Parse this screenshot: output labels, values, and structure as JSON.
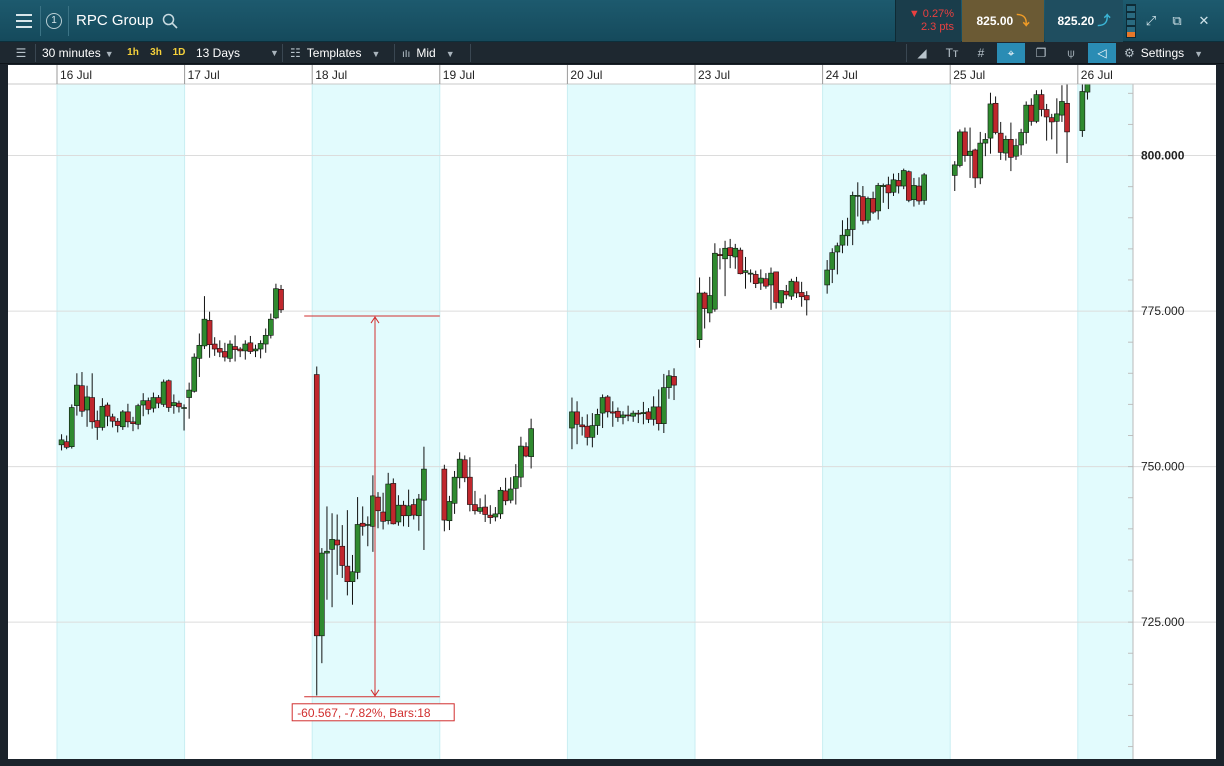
{
  "header": {
    "title": "RPC Group",
    "change_pct": "▼ 0.27%",
    "change_pts": "2.3 pts",
    "sell_price": "825.00",
    "buy_price": "825.20",
    "info_label": "1",
    "colors": {
      "down": "#e94040",
      "sell_arrow": "#f19c26",
      "buy_arrow": "#3bb5d6"
    }
  },
  "toolbar": {
    "interval": "30 minutes",
    "quick_ranges": [
      "1h",
      "3h",
      "1D"
    ],
    "span": "13 Days",
    "templates_label": "Templates",
    "price_type": "Mid",
    "settings_label": "Settings",
    "icons": [
      "list-icon",
      "draw-line-icon",
      "text-tool-icon",
      "grid-icon",
      "crosshair-icon",
      "layers-icon",
      "indicator-icon",
      "tag-icon",
      "gear-icon"
    ]
  },
  "chart_data": {
    "type": "candlestick",
    "x_labels": [
      "16 Jul",
      "17 Jul",
      "18 Jul",
      "19 Jul",
      "20 Jul",
      "23 Jul",
      "24 Jul",
      "25 Jul",
      "26 Jul"
    ],
    "y_ticks": [
      "800.000",
      "775.000",
      "750.000",
      "725.000"
    ],
    "y_tick_values": [
      800,
      775,
      750,
      725
    ],
    "ylim": [
      703,
      811.5
    ],
    "grid": true,
    "colors": {
      "up": "#2f8a2f",
      "down": "#c0272d",
      "band": "#e2fbfd",
      "measure": "#d12f2f"
    },
    "measure": {
      "top": 774.2,
      "bottom": 713,
      "label": "-60.567, -7.82%, Bars:18"
    },
    "days": [
      {
        "label": "16 Jul",
        "ohlc": [
          [
            753.5,
            755.2,
            752.6,
            754.3
          ],
          [
            754,
            755,
            752.8,
            753.1
          ],
          [
            753.2,
            760,
            752.9,
            759.5
          ],
          [
            759.8,
            765,
            758.2,
            763.1
          ],
          [
            763,
            765.2,
            758,
            758.9
          ],
          [
            759.1,
            763,
            756.4,
            761.2
          ],
          [
            761.1,
            765,
            756.1,
            757.2
          ],
          [
            757.4,
            759,
            754.3,
            756.3
          ],
          [
            756.3,
            761,
            755.8,
            759.7
          ],
          [
            759.9,
            760.3,
            756.5,
            758.1
          ],
          [
            758,
            758.5,
            756.3,
            757.3
          ],
          [
            757.3,
            757.8,
            755.5,
            756.6
          ],
          [
            756.4,
            759.1,
            755.9,
            758.8
          ],
          [
            758.8,
            760.1,
            756.3,
            757.2
          ],
          [
            757.2,
            758,
            755.7,
            756.9
          ],
          [
            756.8,
            760.1,
            756,
            759.8
          ],
          [
            759.9,
            761.8,
            758.1,
            760.6
          ],
          [
            760.6,
            761.1,
            758.4,
            759.2
          ],
          [
            759.4,
            761.9,
            758.7,
            761.1
          ],
          [
            761.1,
            761.5,
            759.4,
            760.2
          ],
          [
            760,
            764,
            759.6,
            763.6
          ],
          [
            763.8,
            764,
            758.8,
            759.5
          ],
          [
            759.8,
            761.6,
            758.5,
            760.3
          ],
          [
            760.2,
            760.6,
            758.7,
            759.6
          ],
          [
            759.4,
            760,
            755.8,
            759.5
          ]
        ]
      },
      {
        "label": "17 Jul",
        "ohlc": [
          [
            761.1,
            763.5,
            757.7,
            762.3
          ],
          [
            762.1,
            768.2,
            761.9,
            767.6
          ],
          [
            767.4,
            771.4,
            764.4,
            769.5
          ],
          [
            769.4,
            777.4,
            768.9,
            773.7
          ],
          [
            773.5,
            774.9,
            767.5,
            769.6
          ],
          [
            769.7,
            770.8,
            767.8,
            768.9
          ],
          [
            769,
            770.3,
            767.6,
            768.4
          ],
          [
            768.5,
            769.9,
            766.9,
            767.6
          ],
          [
            767.4,
            770.3,
            766.8,
            769.7
          ],
          [
            769.3,
            771.1,
            766.9,
            768.8
          ],
          [
            768.9,
            769.2,
            767.6,
            768.6
          ],
          [
            768.6,
            770.3,
            767.2,
            769.7
          ],
          [
            769.9,
            771,
            768.1,
            768.5
          ],
          [
            768.6,
            769.6,
            767.6,
            768.9
          ],
          [
            768.9,
            770.3,
            767.4,
            769.8
          ],
          [
            769.7,
            772.2,
            768.3,
            771.1
          ],
          [
            771.1,
            774.6,
            770.6,
            773.7
          ],
          [
            773.9,
            779.4,
            773.7,
            778.6
          ],
          [
            778.5,
            779.2,
            774.7,
            775.2
          ]
        ]
      },
      {
        "label": "18 Jul",
        "ohlc": [
          [
            764.8,
            766.1,
            713.2,
            722.8
          ],
          [
            722.8,
            736.9,
            718.4,
            736.1
          ],
          [
            736.1,
            743.6,
            728.6,
            736.4
          ],
          [
            736.7,
            742.5,
            727.4,
            738.3
          ],
          [
            738.2,
            742.3,
            732.6,
            737.4
          ],
          [
            737.2,
            740.6,
            732.1,
            734.1
          ],
          [
            734,
            743,
            729.3,
            731.5
          ],
          [
            731.5,
            735.8,
            727.8,
            733.1
          ],
          [
            733,
            745.1,
            731.9,
            740.7
          ],
          [
            740.9,
            743.6,
            738.9,
            740.4
          ],
          [
            740.6,
            742,
            737.2,
            740.7
          ],
          [
            740.4,
            748.6,
            736.3,
            745.3
          ],
          [
            745.1,
            745.9,
            740.1,
            742.9
          ],
          [
            742.7,
            745.8,
            739.9,
            741.2
          ],
          [
            741.3,
            749,
            740.7,
            747.2
          ],
          [
            747.3,
            748.1,
            740.7,
            740.8
          ],
          [
            741.1,
            745.4,
            740.5,
            743.8
          ],
          [
            743.8,
            744.5,
            740.4,
            742.1
          ],
          [
            742.1,
            746.3,
            740.3,
            743.7
          ],
          [
            743.9,
            744.8,
            741.5,
            742.2
          ],
          [
            742.1,
            745.6,
            739.7,
            744.8
          ],
          [
            744.6,
            753.2,
            736.6,
            749.6
          ]
        ]
      },
      {
        "label": "19 Jul",
        "ohlc": [
          [
            749.6,
            750.3,
            739.6,
            741.4
          ],
          [
            741.3,
            745.3,
            739.8,
            744.4
          ],
          [
            744.1,
            749.3,
            742.4,
            748.3
          ],
          [
            748.2,
            752.3,
            746.5,
            751.2
          ],
          [
            751.1,
            751.8,
            747.5,
            748.2
          ],
          [
            748.3,
            751.5,
            742.8,
            743.9
          ],
          [
            743.9,
            746.1,
            742.3,
            742.9
          ],
          [
            742.8,
            744.9,
            742.4,
            743.4
          ],
          [
            743.5,
            745.5,
            741.1,
            742.3
          ],
          [
            742.2,
            743.8,
            740.8,
            741.8
          ],
          [
            741.9,
            743.5,
            741.2,
            742.4
          ],
          [
            742.4,
            746.7,
            741.6,
            746.2
          ],
          [
            746.1,
            748.2,
            743.8,
            744.5
          ],
          [
            744.6,
            748.3,
            744.1,
            746.4
          ],
          [
            746.5,
            750.4,
            743.9,
            748.4
          ],
          [
            748.3,
            754.8,
            746.7,
            753.3
          ],
          [
            753.2,
            753.9,
            751.5,
            751.7
          ],
          [
            751.6,
            757.7,
            749.7,
            756.1
          ]
        ]
      },
      {
        "label": "20 Jul",
        "ohlc": [
          [
            756.2,
            761.1,
            752.8,
            758.8
          ],
          [
            758.8,
            760.5,
            753.6,
            756.8
          ],
          [
            756.7,
            758,
            755,
            756.4
          ],
          [
            756.5,
            758.4,
            753.4,
            754.7
          ],
          [
            754.7,
            758.6,
            753.1,
            756.6
          ],
          [
            756.6,
            759.3,
            755.1,
            758.4
          ],
          [
            758.6,
            761.6,
            756.2,
            761.1
          ],
          [
            761.2,
            761.5,
            757.9,
            758.8
          ],
          [
            758.8,
            760.5,
            756.4,
            758.6
          ],
          [
            758.9,
            759.5,
            757.2,
            757.9
          ],
          [
            757.9,
            758.9,
            756.8,
            758.3
          ],
          [
            758.3,
            759.8,
            757.3,
            758.2
          ],
          [
            758.1,
            759,
            757.2,
            758.6
          ],
          [
            758.6,
            759.1,
            757,
            758.5
          ],
          [
            758.5,
            760.4,
            756.8,
            758.7
          ],
          [
            758.8,
            759.4,
            757,
            757.6
          ],
          [
            757.6,
            761.3,
            756.6,
            759.6
          ],
          [
            759.6,
            762.4,
            755.8,
            756.9
          ],
          [
            756.9,
            764.9,
            755.4,
            762.7
          ],
          [
            762.7,
            765.5,
            760.9,
            764.6
          ],
          [
            764.5,
            765.8,
            760.7,
            763.1
          ]
        ]
      },
      {
        "label": "23 Jul",
        "ohlc": [
          [
            770.4,
            780.4,
            769.1,
            777.9
          ],
          [
            777.9,
            778.1,
            772.2,
            775.4
          ],
          [
            774.7,
            780.5,
            773.2,
            777.5
          ],
          [
            775.3,
            785.9,
            774.9,
            784.3
          ],
          [
            784.1,
            785.1,
            781.7,
            783.9
          ],
          [
            783.4,
            786.3,
            777.4,
            785.1
          ],
          [
            785.2,
            786.6,
            781.9,
            783.9
          ],
          [
            783.7,
            785.8,
            781.8,
            785.1
          ],
          [
            784.8,
            785.2,
            780.9,
            781
          ],
          [
            781.2,
            783.7,
            778.6,
            781.5
          ],
          [
            781.1,
            781.7,
            779.6,
            781.1
          ],
          [
            780.9,
            781.5,
            778.7,
            779.4
          ],
          [
            779.5,
            781.7,
            778.4,
            780.3
          ],
          [
            780.2,
            781.1,
            778.6,
            779
          ],
          [
            779.2,
            782,
            775.2,
            781.1
          ],
          [
            781.3,
            781.3,
            775.4,
            776.4
          ],
          [
            776.3,
            778.3,
            775.5,
            778.3
          ],
          [
            778.2,
            779.2,
            776.9,
            777.6
          ],
          [
            777.4,
            780.2,
            776.8,
            779.8
          ],
          [
            779.7,
            780.5,
            777.1,
            777.9
          ],
          [
            778,
            779.7,
            775.7,
            777.3
          ],
          [
            777.5,
            778.2,
            774.3,
            776.8
          ]
        ]
      },
      {
        "label": "24 Jul",
        "ohlc": [
          [
            779.2,
            783.2,
            777.8,
            781.6
          ],
          [
            781.7,
            785.1,
            779.5,
            784.4
          ],
          [
            784.5,
            786,
            780.9,
            785.5
          ],
          [
            785.6,
            789.6,
            784.3,
            787.2
          ],
          [
            787.1,
            790,
            785.5,
            788.1
          ],
          [
            788.1,
            794.2,
            785.6,
            793.6
          ],
          [
            793.5,
            795.7,
            790.2,
            793.6
          ],
          [
            793.4,
            795.1,
            788.9,
            789.5
          ],
          [
            789.6,
            793.4,
            789.1,
            793.1
          ],
          [
            793.1,
            794.2,
            790.6,
            790.9
          ],
          [
            791.1,
            795.6,
            789.7,
            795.2
          ],
          [
            795,
            795.5,
            792.4,
            795.2
          ],
          [
            795.3,
            796.6,
            791.4,
            794
          ],
          [
            794.1,
            797.1,
            793.5,
            796.1
          ],
          [
            796,
            797.2,
            793.9,
            795.1
          ],
          [
            795.1,
            797.9,
            794.6,
            797.6
          ],
          [
            797.4,
            797.6,
            792.5,
            792.8
          ],
          [
            792.9,
            796.4,
            791.8,
            795.2
          ],
          [
            795.1,
            796.5,
            792.1,
            792.7
          ],
          [
            792.8,
            797.2,
            792.1,
            796.9
          ]
        ]
      },
      {
        "label": "25 Jul",
        "ohlc": [
          [
            796.8,
            799.1,
            794.3,
            798.5
          ],
          [
            798.4,
            804.2,
            798.1,
            803.8
          ],
          [
            803.8,
            804.5,
            799,
            800
          ],
          [
            800,
            804.5,
            796.4,
            800.7
          ],
          [
            800.9,
            801.1,
            794.8,
            796.4
          ],
          [
            796.4,
            803.8,
            795.4,
            802
          ],
          [
            802,
            803.6,
            799.9,
            802.6
          ],
          [
            802.8,
            810.1,
            800.3,
            808.3
          ],
          [
            808.4,
            809.5,
            803.4,
            803.7
          ],
          [
            803.6,
            805.4,
            799.3,
            800.5
          ],
          [
            800.4,
            803.2,
            799.2,
            802.6
          ],
          [
            802.6,
            805.3,
            797.5,
            799.7
          ],
          [
            799.9,
            802.7,
            799.3,
            801.6
          ],
          [
            801.7,
            804.3,
            800.1,
            803.7
          ],
          [
            803.7,
            808.7,
            801.9,
            808.1
          ],
          [
            808.1,
            809.2,
            804.8,
            805.5
          ],
          [
            805.5,
            810.5,
            805.2,
            809.8
          ],
          [
            809.8,
            810.6,
            806.3,
            807.4
          ],
          [
            807.4,
            808.3,
            802.4,
            806.2
          ],
          [
            806.1,
            806.7,
            802.6,
            805.4
          ],
          [
            805.5,
            809.2,
            800.3,
            806.7
          ],
          [
            806.5,
            811.3,
            805.4,
            808.7
          ],
          [
            808.4,
            812.4,
            798.8,
            803.8
          ]
        ]
      },
      {
        "label": "26 Jul",
        "ohlc": [
          [
            804,
            812,
            803,
            810.3
          ],
          [
            810.2,
            813,
            809,
            812.5
          ]
        ]
      }
    ]
  }
}
